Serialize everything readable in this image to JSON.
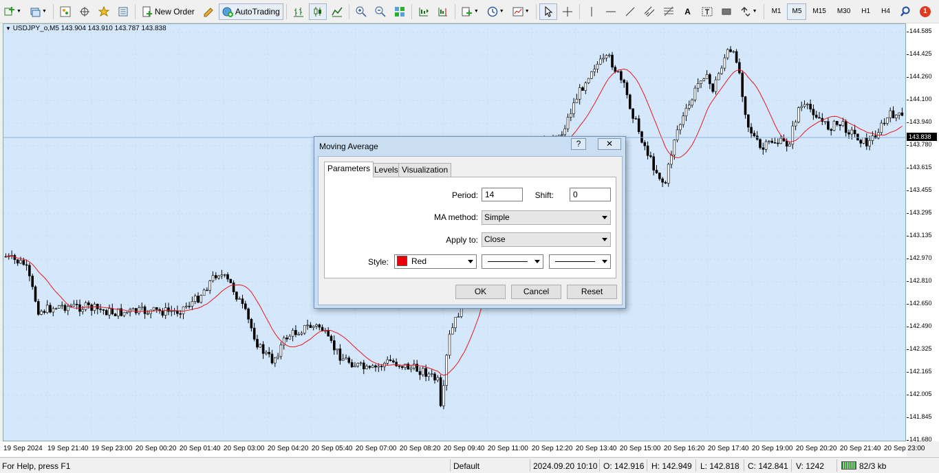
{
  "toolbar": {
    "new_order_label": "New Order",
    "autotrading_label": "AutoTrading",
    "timeframes": [
      "M1",
      "M5",
      "M15",
      "M30",
      "H1",
      "H4"
    ],
    "active_timeframe": "M5",
    "notification_count": "1"
  },
  "chart": {
    "symbol_info": "USDJPY_o,M5  143.904 143.910 143.787 143.838",
    "current_price": "143.838",
    "price_labels": [
      "144.585",
      "144.425",
      "144.260",
      "144.100",
      "143.940",
      "143.780",
      "143.615",
      "143.455",
      "143.295",
      "143.135",
      "142.970",
      "142.810",
      "142.650",
      "142.490",
      "142.325",
      "142.165",
      "142.005",
      "141.845",
      "141.680"
    ],
    "time_labels": [
      "19 Sep 2024",
      "19 Sep 21:40",
      "19 Sep 23:00",
      "20 Sep 00:20",
      "20 Sep 01:40",
      "20 Sep 03:00",
      "20 Sep 04:20",
      "20 Sep 05:40",
      "20 Sep 07:00",
      "20 Sep 08:20",
      "20 Sep 09:40",
      "20 Sep 11:00",
      "20 Sep 12:20",
      "20 Sep 13:40",
      "20 Sep 15:00",
      "20 Sep 16:20",
      "20 Sep 17:40",
      "20 Sep 19:00",
      "20 Sep 20:20",
      "20 Sep 21:40",
      "20 Sep 23:00"
    ],
    "colors": {
      "background": "#d5e8fb",
      "candle": "#000000",
      "ma_line": "#e8141e"
    }
  },
  "dialog": {
    "title": "Moving Average",
    "help_glyph": "?",
    "close_glyph": "✕",
    "tabs": [
      "Parameters",
      "Levels",
      "Visualization"
    ],
    "active_tab": "Parameters",
    "period_label": "Period:",
    "period_value": "14",
    "shift_label": "Shift:",
    "shift_value": "0",
    "ma_method_label": "MA method:",
    "ma_method_value": "Simple",
    "apply_to_label": "Apply to:",
    "apply_to_value": "Close",
    "style_label": "Style:",
    "style_color_name": "Red",
    "style_color": "#e8000b",
    "ok_label": "OK",
    "cancel_label": "Cancel",
    "reset_label": "Reset"
  },
  "status": {
    "help_text": "For Help, press F1",
    "profile": "Default",
    "datetime": "2024.09.20 10:10",
    "open": "O: 142.916",
    "high": "H: 142.949",
    "low": "L: 142.818",
    "close": "C: 142.841",
    "volume": "V: 1242",
    "traffic": "82/3 kb"
  }
}
